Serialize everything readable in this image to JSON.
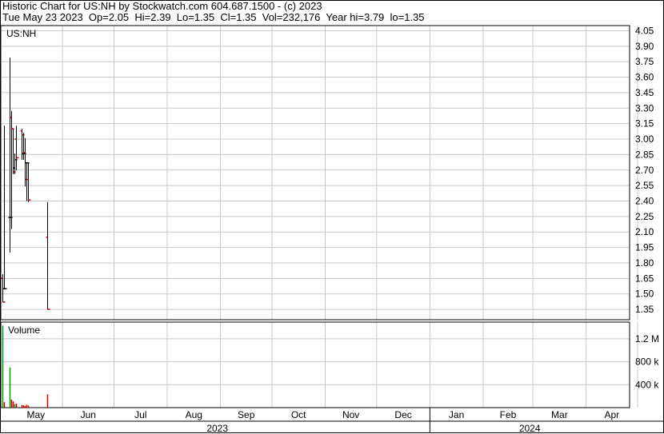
{
  "header": {
    "line1": "Historic Chart for US:NH by Stockwatch.com 604.687.1500 - (c) 2023",
    "line2": "Tue May 23 2023  Op=2.05  Hi=2.39  Lo=1.35  Cl=1.35  Vol=232,176  Year hi=3.79  lo=1.35"
  },
  "colors": {
    "up": "#000000",
    "down": "#cc0000",
    "volume_up": "#009900",
    "volume_down": "#cc0000",
    "grid": "#c8c8c8"
  },
  "chart_data": [
    {
      "type": "ohlc",
      "title": "US:NH",
      "ylim": [
        1.25,
        4.1
      ],
      "ytick_labels": [
        "4.05",
        "3.90",
        "3.75",
        "3.60",
        "3.45",
        "3.30",
        "3.15",
        "3.00",
        "2.85",
        "2.70",
        "2.55",
        "2.40",
        "2.25",
        "2.10",
        "1.95",
        "1.80",
        "1.65",
        "1.50",
        "1.35"
      ],
      "x_tick_labels": [
        "May",
        "Jun",
        "Jul",
        "Aug",
        "Sep",
        "Oct",
        "Nov",
        "Dec",
        "Jan",
        "Feb",
        "Mar",
        "Apr"
      ],
      "year_labels": [
        "2023",
        "2024"
      ],
      "grid": true,
      "bars": [
        {
          "date": "2023-04-27",
          "open": 1.65,
          "high": 1.69,
          "low": 1.42,
          "close": 1.42
        },
        {
          "date": "2023-04-28",
          "open": 1.55,
          "high": 3.13,
          "low": 1.55,
          "close": 1.55
        },
        {
          "date": "2023-05-01",
          "open": 2.24,
          "high": 3.79,
          "low": 1.9,
          "close": 2.24
        },
        {
          "date": "2023-05-02",
          "open": 3.21,
          "high": 3.27,
          "low": 2.13,
          "close": 3.1
        },
        {
          "date": "2023-05-03",
          "open": 3.1,
          "high": 3.1,
          "low": 2.66,
          "close": 2.68
        },
        {
          "date": "2023-05-04",
          "open": 2.72,
          "high": 2.86,
          "low": 2.66,
          "close": 2.8
        },
        {
          "date": "2023-05-05",
          "open": 3.0,
          "high": 3.13,
          "low": 2.7,
          "close": 2.82
        },
        {
          "date": "2023-05-08",
          "open": 3.08,
          "high": 3.1,
          "low": 2.8,
          "close": 3.04
        },
        {
          "date": "2023-05-09",
          "open": 2.86,
          "high": 3.06,
          "low": 2.8,
          "close": 2.86
        },
        {
          "date": "2023-05-10",
          "open": 2.87,
          "high": 3.01,
          "low": 2.54,
          "close": 2.61
        },
        {
          "date": "2023-05-11",
          "open": 2.77,
          "high": 2.77,
          "low": 2.4,
          "close": 2.77
        },
        {
          "date": "2023-05-12",
          "open": 2.61,
          "high": 2.77,
          "low": 2.39,
          "close": 2.41
        },
        {
          "date": "2023-05-23",
          "open": 2.05,
          "high": 2.39,
          "low": 1.35,
          "close": 1.35
        }
      ]
    },
    {
      "type": "bar",
      "title": "Volume",
      "ylim": [
        0,
        1450000
      ],
      "ytick_labels": [
        "1.2 M",
        "800 k",
        "400 k"
      ],
      "volumes": [
        {
          "date": "2023-04-27",
          "volume": 1430000,
          "up": true
        },
        {
          "date": "2023-04-28",
          "volume": 95000,
          "up": false
        },
        {
          "date": "2023-05-01",
          "volume": 700000,
          "up": true
        },
        {
          "date": "2023-05-02",
          "volume": 140000,
          "up": false
        },
        {
          "date": "2023-05-03",
          "volume": 110000,
          "up": false
        },
        {
          "date": "2023-05-04",
          "volume": 60000,
          "up": true
        },
        {
          "date": "2023-05-05",
          "volume": 70000,
          "up": false
        },
        {
          "date": "2023-05-08",
          "volume": 45000,
          "up": false
        },
        {
          "date": "2023-05-09",
          "volume": 40000,
          "up": false
        },
        {
          "date": "2023-05-10",
          "volume": 30000,
          "up": false
        },
        {
          "date": "2023-05-11",
          "volume": 50000,
          "up": false
        },
        {
          "date": "2023-05-12",
          "volume": 35000,
          "up": false
        },
        {
          "date": "2023-05-23",
          "volume": 232176,
          "up": false
        }
      ]
    }
  ]
}
